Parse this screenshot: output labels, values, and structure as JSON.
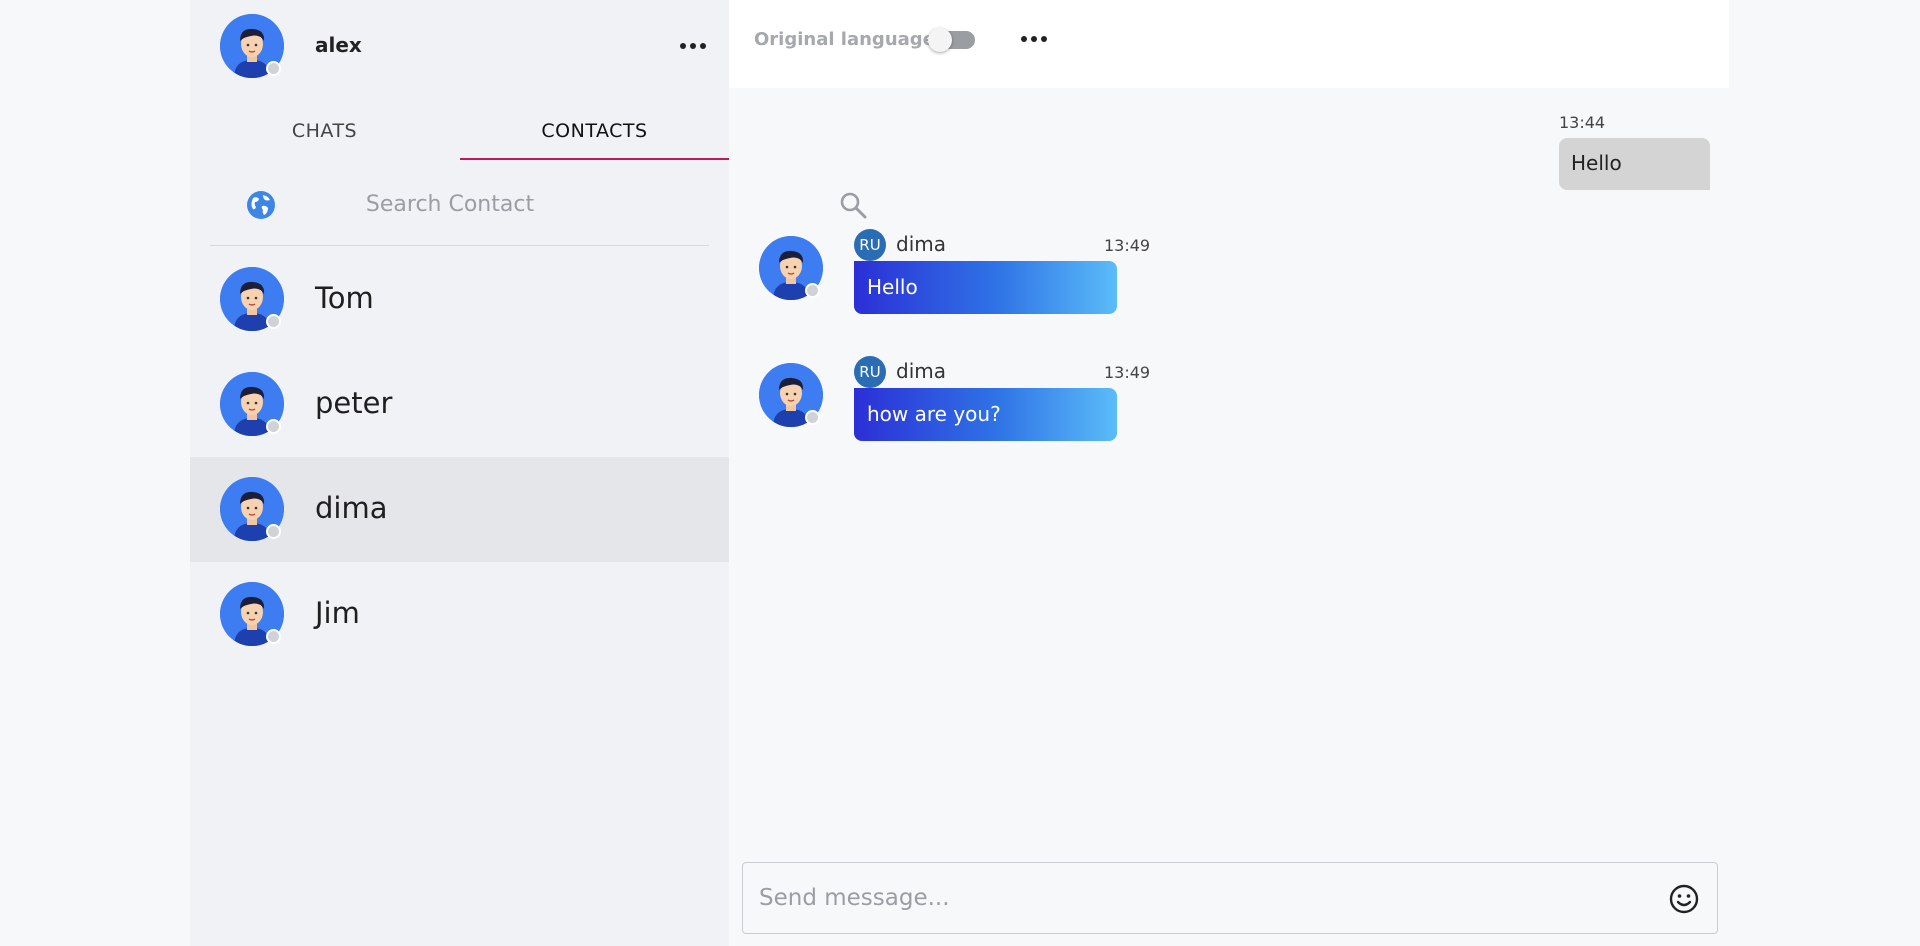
{
  "profile": {
    "name": "alex",
    "menu_icon": "more-horizontal-icon",
    "avatar_icon": "user-avatar-icon"
  },
  "tabs": [
    {
      "label": "CHATS",
      "active": false
    },
    {
      "label": "CONTACTS",
      "active": true
    }
  ],
  "search": {
    "placeholder": "Search Contact",
    "value": "",
    "left_icon": "globe-icon",
    "right_icon": "search-icon"
  },
  "contacts": [
    {
      "name": "Tom",
      "selected": false
    },
    {
      "name": "peter",
      "selected": false
    },
    {
      "name": "dima",
      "selected": true
    },
    {
      "name": "Jim",
      "selected": false
    }
  ],
  "chat_header": {
    "toggle_label": "Original language",
    "toggle_on": false,
    "menu_icon": "more-horizontal-icon"
  },
  "messages": [
    {
      "direction": "outgoing",
      "time": "13:44",
      "text": "Hello"
    },
    {
      "direction": "incoming",
      "lang": "RU",
      "sender": "dima",
      "time": "13:49",
      "text": "Hello"
    },
    {
      "direction": "incoming",
      "lang": "RU",
      "sender": "dima",
      "time": "13:49",
      "text": "how are you?"
    }
  ],
  "compose": {
    "placeholder": "Send message...",
    "value": "",
    "emoji_icon": "smiley-icon"
  },
  "colors": {
    "tab_underline": "#c2185b",
    "bubble_gradient_start": "#2b2fd6",
    "bubble_gradient_end": "#5bbcf8",
    "outgoing_bubble": "#d4d4d4",
    "avatar_bg": "#3d7cf1",
    "lang_badge": "#2b6db5"
  }
}
